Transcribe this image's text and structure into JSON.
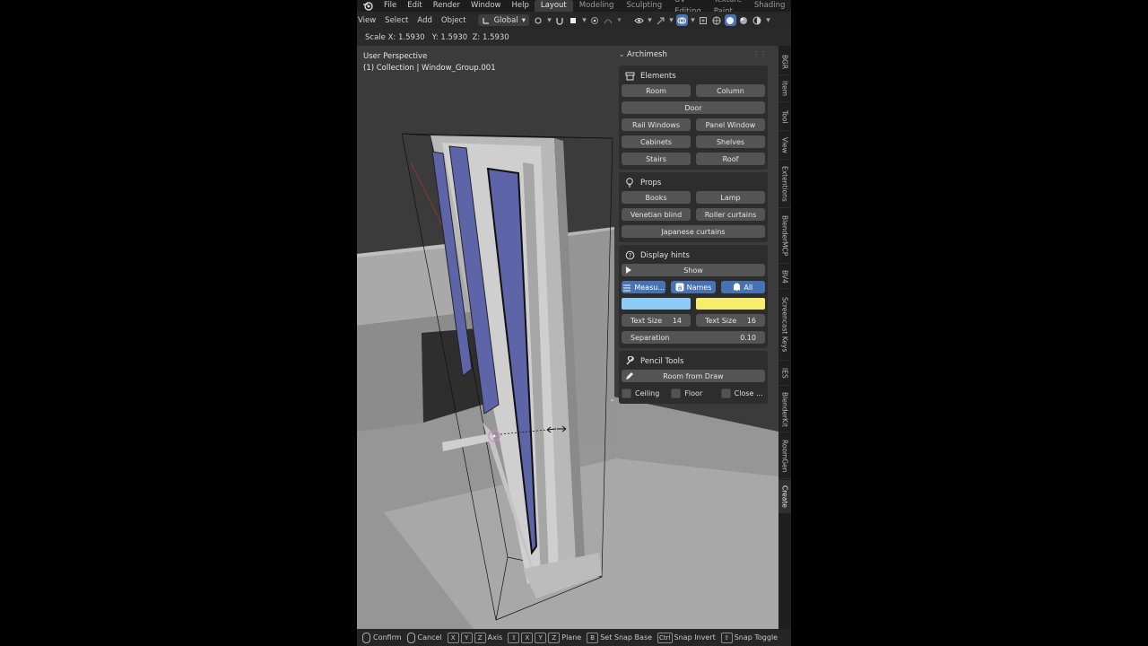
{
  "menubar": {
    "items": [
      "File",
      "Edit",
      "Render",
      "Window",
      "Help"
    ],
    "workspaces": [
      "Layout",
      "Modeling",
      "Sculpting",
      "UV Editing",
      "Texture Paint",
      "Shading"
    ],
    "active_workspace": "Layout"
  },
  "header": {
    "menus": [
      "View",
      "Select",
      "Add",
      "Object"
    ],
    "orientation": "Global"
  },
  "operator_status": "Scale X: 1.5930   Y: 1.5930  Z: 1.5930",
  "viewport": {
    "view_name": "User Perspective",
    "collection_info": "(1) Collection | Window_Group.001"
  },
  "panel": {
    "title": "Archimesh",
    "elements": {
      "title": "Elements",
      "buttons": [
        "Room",
        "Column",
        "Door",
        "Rail Windows",
        "Panel Window",
        "Cabinets",
        "Shelves",
        "Stairs",
        "Roof"
      ]
    },
    "props": {
      "title": "Props",
      "buttons": [
        "Books",
        "Lamp",
        "Venetian blind",
        "Roller curtains",
        "Japanese curtains"
      ]
    },
    "hints": {
      "title": "Display hints",
      "show": "Show",
      "toggles": [
        "Measu...",
        "Names",
        "All"
      ],
      "color_left": "#8ecbf5",
      "color_right": "#f5ee6a",
      "text_size_label": "Text Size",
      "text_size_left": "14",
      "text_size_right": "16",
      "separation_label": "Separation",
      "separation_value": "0.10"
    },
    "pencil": {
      "title": "Pencil Tools",
      "room_from_draw": "Room from Draw",
      "checks": [
        "Ceiling",
        "Floor",
        "Close ..."
      ]
    }
  },
  "side_tabs": [
    "BGR",
    "Item",
    "Tool",
    "View",
    "Extentions",
    "BlenderMCP",
    "BV4",
    "Screencast Keys",
    "IES",
    "BlenderKit",
    "RoomGen",
    "Create"
  ],
  "active_side_tab": "Create",
  "statusbar": {
    "confirm": "Confirm",
    "cancel": "Cancel",
    "axis_keys": [
      "X",
      "Y",
      "Z"
    ],
    "axis": "Axis",
    "plane_keys": [
      "X",
      "Y",
      "Z"
    ],
    "plane": "Plane",
    "snap_base_key": "B",
    "snap_base": "Set Snap Base",
    "ctrl_key": "Ctrl",
    "snap_invert": "Snap Invert",
    "snap_toggle": "Snap Toggle"
  },
  "colors": {
    "accent": "#4772b3",
    "glass": "#5e64a8",
    "frame": "#b4b4b4"
  }
}
